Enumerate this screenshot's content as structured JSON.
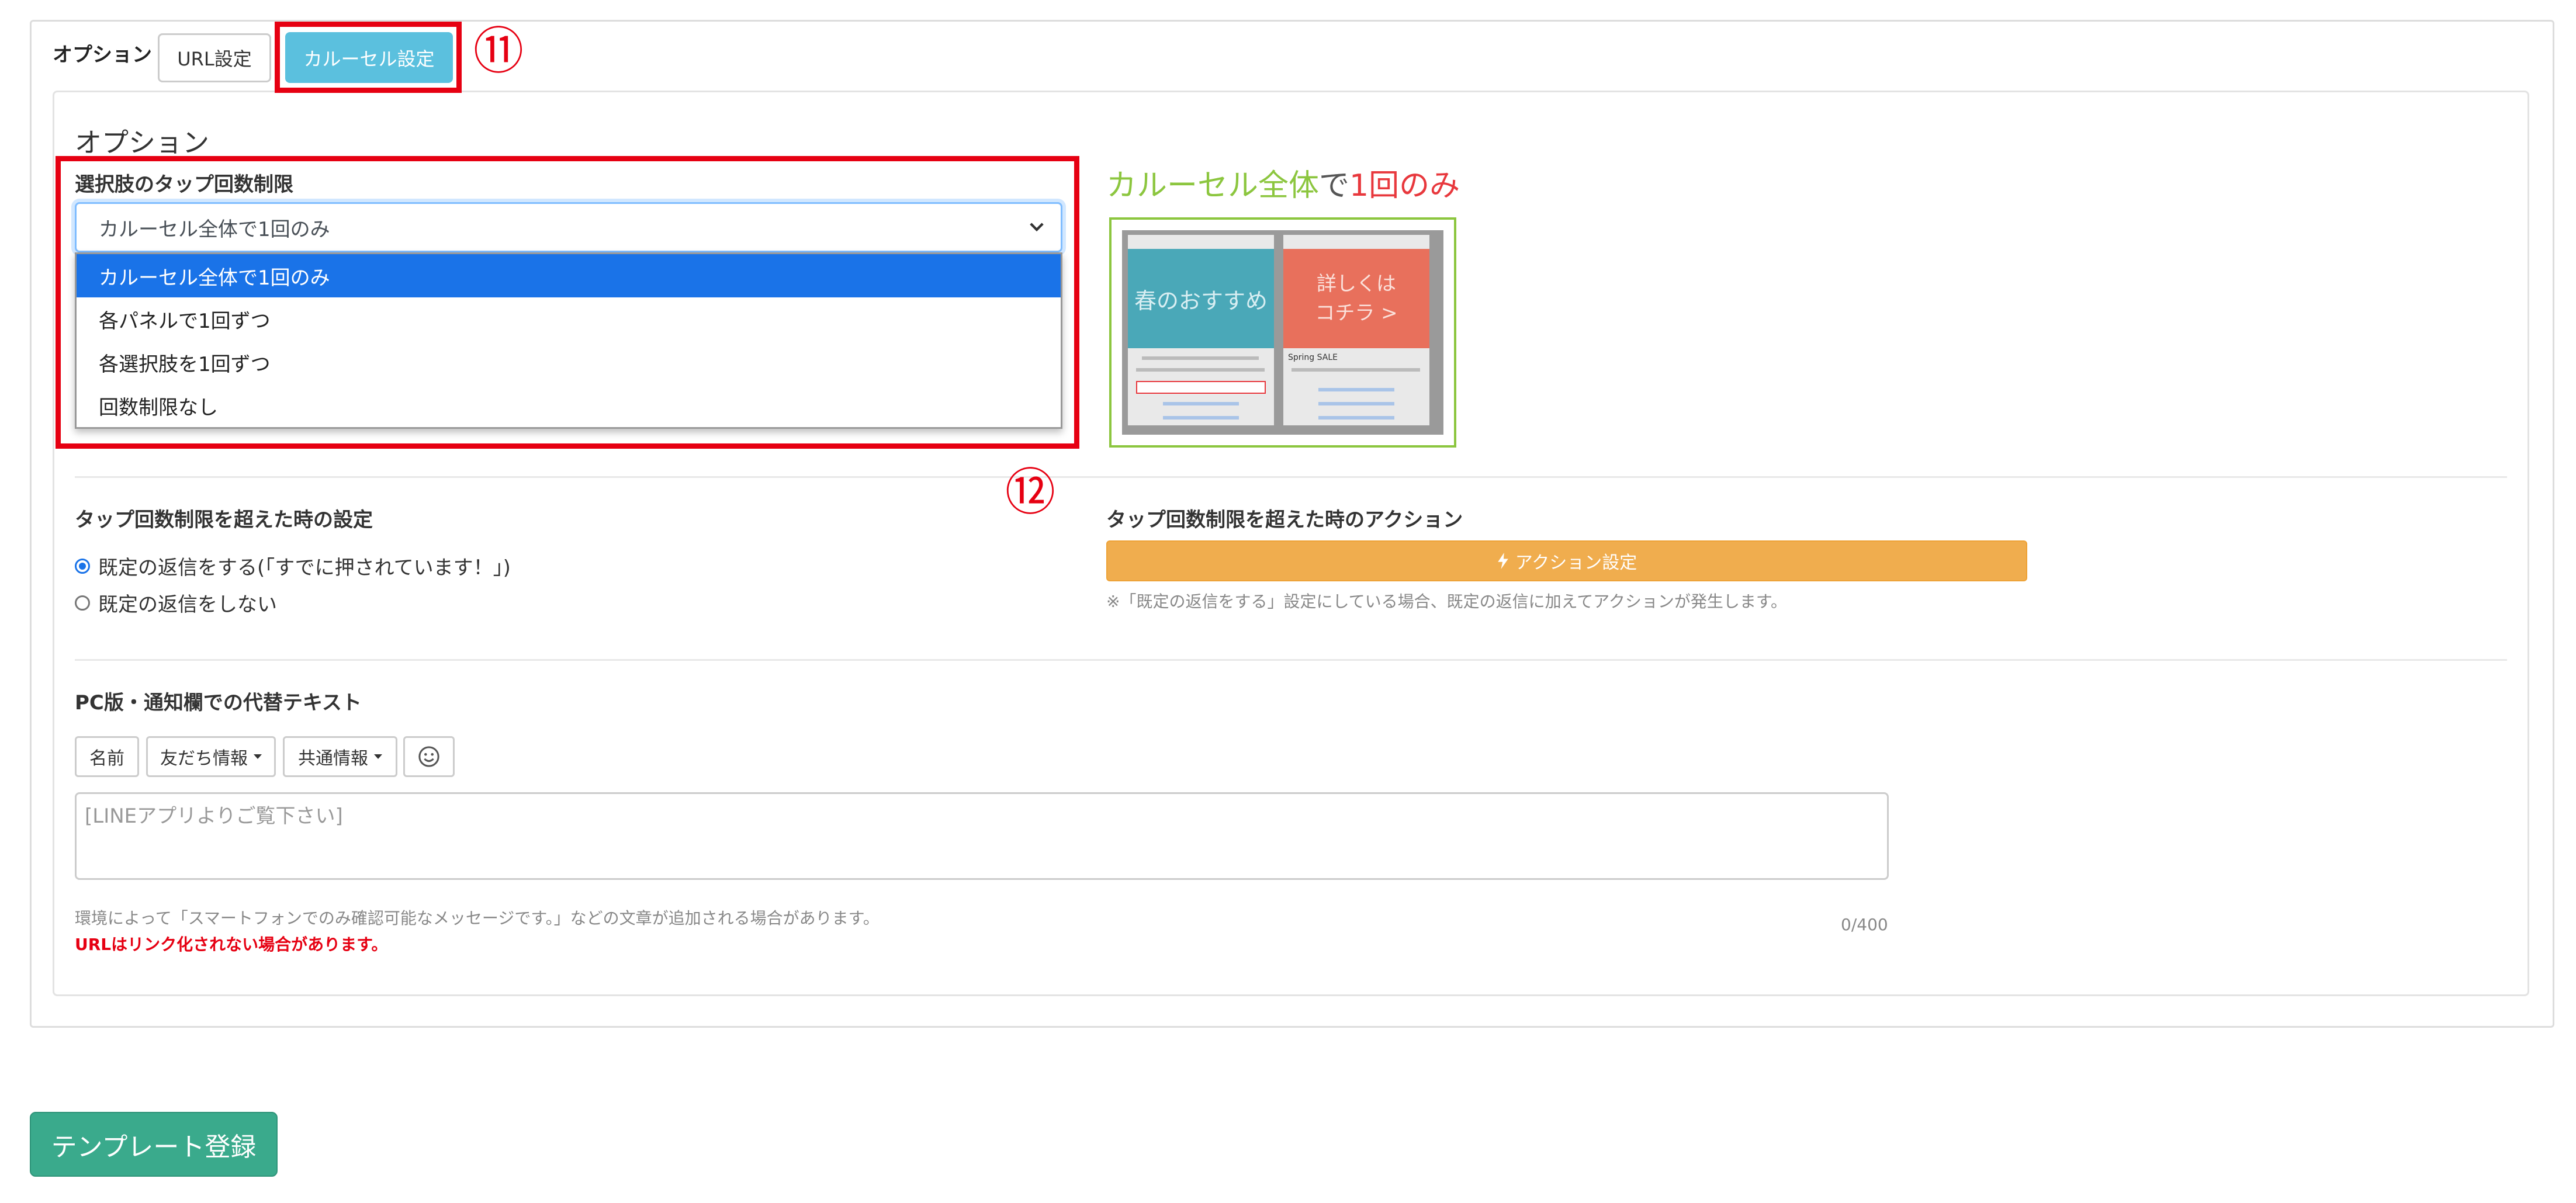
{
  "header": {
    "options_label": "オプション",
    "tab_url": "URL設定",
    "tab_carousel": "カルーセル設定",
    "callout_11": "⑪"
  },
  "options": {
    "section_title": "オプション",
    "tap_limit_label": "選択肢のタップ回数制限",
    "tap_limit_selected": "カルーセル全体で1回のみ",
    "tap_limit_options": [
      "カルーセル全体で1回のみ",
      "各パネルで1回ずつ",
      "各選択肢を1回ずつ",
      "回数制限なし"
    ],
    "callout_12": "⑫"
  },
  "preview": {
    "title_part1": "カルーセル全体",
    "title_part2": "で",
    "title_part3": "1回のみ",
    "panel1_text": "春のおすすめ",
    "panel2_text_line1": "詳しくは",
    "panel2_text_line2": "コチラ >",
    "panel2_caption": "Spring SALE",
    "colors": {
      "green": "#8cc63f",
      "red": "#e8383d",
      "teal_panel": "#4aa8b8",
      "coral_panel": "#e8705c"
    }
  },
  "exceed": {
    "label": "タップ回数制限を超えた時の設定",
    "radio_reply": "既定の返信をする(「すでに押されています！」)",
    "radio_no_reply": "既定の返信をしない",
    "selected": "reply"
  },
  "action": {
    "label": "タップ回数制限を超えた時のアクション",
    "button": "アクション設定",
    "button_icon": "bolt-icon",
    "note": "※「既定の返信をする」設定にしている場合、既定の返信に加えてアクションが発生します。"
  },
  "alt_text": {
    "label": "PC版・通知欄での代替テキスト",
    "btn_name": "名前",
    "btn_friend": "友だち情報",
    "btn_common": "共通情報",
    "emoji_icon": "smiley-icon",
    "placeholder": "[LINEアプリよりご覧下さい]",
    "counter": "0/400",
    "note": "環境によって「スマートフォンでのみ確認可能なメッセージです。」などの文章が追加される場合があります。",
    "warning": "URLはリンク化されない場合があります。"
  },
  "footer": {
    "register_button": "テンプレート登録"
  },
  "theme": {
    "highlight_red": "#e60012",
    "info_blue": "#5bc0de",
    "warning_orange": "#f0ad4e",
    "success_green": "#3aaa8c",
    "select_blue": "#1a73e8"
  }
}
